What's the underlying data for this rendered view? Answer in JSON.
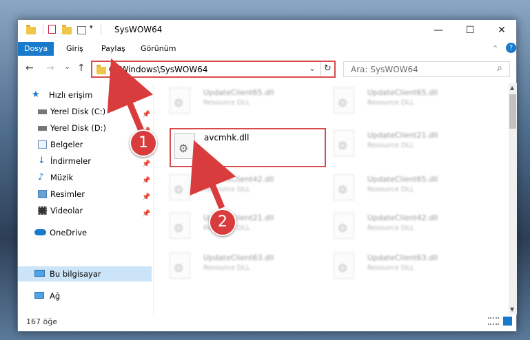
{
  "window": {
    "title": "SysWOW64",
    "controls": {
      "minimize": "—",
      "maximize": "☐",
      "close": "✕"
    }
  },
  "ribbon": {
    "tabs": [
      {
        "label": "Dosya",
        "active": true
      },
      {
        "label": "Giriş"
      },
      {
        "label": "Paylaş"
      },
      {
        "label": "Görünüm"
      }
    ],
    "help": "?",
    "collapse": "⌃"
  },
  "nav": {
    "back": "←",
    "forward": "→",
    "recent": "⌄",
    "up": "↑",
    "address": "C:\\Windows\\SysWOW64",
    "dropdown": "⌄",
    "refresh": "↻",
    "search_placeholder": "Ara: SysWOW64",
    "search_icon": "⌕"
  },
  "sidebar": {
    "quick_access": "Hızlı erişim",
    "items": [
      {
        "label": "Yerel Disk (C:)",
        "icon": "drive-icon",
        "pinned": true
      },
      {
        "label": "Yerel Disk (D:)",
        "icon": "drive-icon",
        "pinned": true
      },
      {
        "label": "Belgeler",
        "icon": "documents-icon",
        "pinned": true
      },
      {
        "label": "İndirmeler",
        "icon": "downloads-icon",
        "pinned": true
      },
      {
        "label": "Müzik",
        "icon": "music-icon",
        "pinned": true
      },
      {
        "label": "Resimler",
        "icon": "pictures-icon",
        "pinned": true
      },
      {
        "label": "Videolar",
        "icon": "videos-icon",
        "pinned": true
      }
    ],
    "onedrive": "OneDrive",
    "this_pc": "Bu bilgisayar",
    "network": "Ağ",
    "pin_glyph": "📌"
  },
  "files": {
    "highlighted": {
      "name": "avcmhk.dll"
    },
    "left_column": [
      {
        "name": "UpdateClient65.dll",
        "type": "Resource DLL"
      },
      {
        "name": "UpdateClient42.dll",
        "type": "Resource DLL"
      },
      {
        "name": "UpdateClient21.dll",
        "type": "Resource DLL"
      },
      {
        "name": "UpdateClient63.dll",
        "type": "Resource DLL"
      }
    ],
    "right_column": [
      {
        "name": "UpdateClient65.dll",
        "type": "Resource DLL"
      },
      {
        "name": "UpdateClient21.dll",
        "type": "Resource DLL"
      },
      {
        "name": "UpdateClient65.dll",
        "type": "Resource DLL"
      },
      {
        "name": "UpdateClient42.dll",
        "type": "Resource DLL"
      },
      {
        "name": "UpdateClient63.dll",
        "type": "Resource DLL"
      }
    ]
  },
  "status": {
    "count": "167 öğe"
  },
  "callouts": {
    "one": "1",
    "two": "2"
  },
  "colors": {
    "accent": "#1979ca",
    "highlight": "#d94b4b",
    "selected": "#cce4f7"
  }
}
